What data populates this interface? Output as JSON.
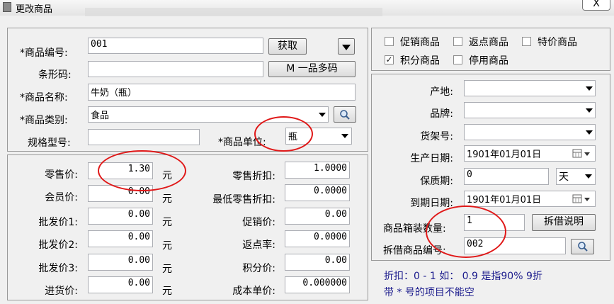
{
  "window": {
    "title": "更改商品",
    "close_glyph": "X"
  },
  "basic": {
    "code_label": "*商品编号:",
    "code_value": "001",
    "fetch_button": "获取",
    "barcode_label": "条形码:",
    "barcode_value": "",
    "multi_code_button": "M 一品多码",
    "name_label": "*商品名称:",
    "name_value": "牛奶（瓶）",
    "category_label": "*商品类别:",
    "category_value": "食品",
    "spec_label": "规格型号:",
    "spec_value": "",
    "unit_label": "*商品单位:",
    "unit_value": "瓶"
  },
  "prices": {
    "yuan": "元",
    "retail_label": "零售价:",
    "retail_value": "1.30",
    "member_label": "会员价:",
    "member_value": "0.00",
    "wholesale1_label": "批发价1:",
    "wholesale1_value": "0.00",
    "wholesale2_label": "批发价2:",
    "wholesale2_value": "0.00",
    "wholesale3_label": "批发价3:",
    "wholesale3_value": "0.00",
    "purchase_label": "进货价:",
    "purchase_value": "0.00",
    "retail_discount_label": "零售折扣:",
    "retail_discount_value": "1.0000",
    "min_discount_label": "最低零售折扣:",
    "min_discount_value": "0.0000",
    "promo_label": "促销价:",
    "promo_value": "0.00",
    "rebate_label": "返点率:",
    "rebate_value": "0.0000",
    "points_label": "积分价:",
    "points_value": "0.00",
    "cost_label": "成本单价:",
    "cost_value": "0.000000"
  },
  "flags": {
    "promo": {
      "label": "促销商品",
      "checked": false
    },
    "rebate": {
      "label": "返点商品",
      "checked": false
    },
    "special": {
      "label": "特价商品",
      "checked": false
    },
    "points": {
      "label": "积分商品",
      "checked": true
    },
    "disabled": {
      "label": "停用商品",
      "checked": false
    }
  },
  "details": {
    "origin_label": "产地:",
    "origin_value": "",
    "brand_label": "品牌:",
    "brand_value": "",
    "shelf_label": "货架号:",
    "shelf_value": "",
    "mfg_date_label": "生产日期:",
    "mfg_date_value": "1901年01月01日",
    "shelf_life_label": "保质期:",
    "shelf_life_value": "0",
    "shelf_life_unit": "天",
    "expiry_label": "到期日期:",
    "expiry_value": "1901年01月01日",
    "box_qty_label": "商品箱装数量:",
    "box_qty_value": "1",
    "split_button": "拆借说明",
    "split_code_label": "拆借商品编号:",
    "split_code_value": "002"
  },
  "hints": {
    "line1": "折扣：0 - 1  如： 0.9 是指90%  9折",
    "line2": "带 * 号的项目不能空"
  },
  "colors": {
    "annotation": "#e01818",
    "hint": "#1a1a8c"
  }
}
